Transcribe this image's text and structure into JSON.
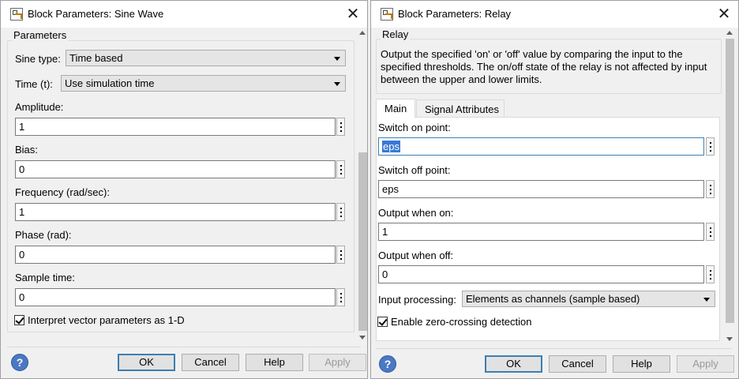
{
  "sine_dialog": {
    "title": "Block Parameters: Sine Wave",
    "group_label": "Parameters",
    "sine_type_label": "Sine type:",
    "sine_type_value": "Time based",
    "time_label": "Time (t):",
    "time_value": "Use simulation time",
    "amplitude_label": "Amplitude:",
    "amplitude_value": "1",
    "bias_label": "Bias:",
    "bias_value": "0",
    "frequency_label": "Frequency (rad/sec):",
    "frequency_value": "1",
    "phase_label": "Phase (rad):",
    "phase_value": "0",
    "sample_time_label": "Sample time:",
    "sample_time_value": "0",
    "interpret_label": "Interpret vector parameters as 1-D",
    "interpret_checked": true,
    "buttons": {
      "ok": "OK",
      "cancel": "Cancel",
      "help": "Help",
      "apply": "Apply"
    },
    "help_icon": "?"
  },
  "relay_dialog": {
    "title": "Block Parameters: Relay",
    "group_label": "Relay",
    "description": "Output the specified 'on' or 'off' value by comparing the input to the specified thresholds.  The on/off state of the relay is not affected by input between the upper and lower limits.",
    "tabs": {
      "main": "Main",
      "signal_attributes": "Signal Attributes"
    },
    "switch_on_label": "Switch on point:",
    "switch_on_value": "eps",
    "switch_off_label": "Switch off point:",
    "switch_off_value": "eps",
    "output_on_label": "Output when on:",
    "output_on_value": "1",
    "output_off_label": "Output when off:",
    "output_off_value": "0",
    "input_processing_label": "Input processing:",
    "input_processing_value": "Elements as channels (sample based)",
    "zero_crossing_label": "Enable zero-crossing detection",
    "zero_crossing_checked": true,
    "buttons": {
      "ok": "OK",
      "cancel": "Cancel",
      "help": "Help",
      "apply": "Apply"
    },
    "help_icon": "?"
  },
  "icons": {
    "close": "close-icon",
    "app": "simulink-block-icon",
    "more": "vertical-ellipsis-icon",
    "help": "help-icon"
  },
  "colors": {
    "selection": "#3878d7",
    "default_button_border": "#3c7fb1",
    "help_icon": "#4a78c4"
  }
}
